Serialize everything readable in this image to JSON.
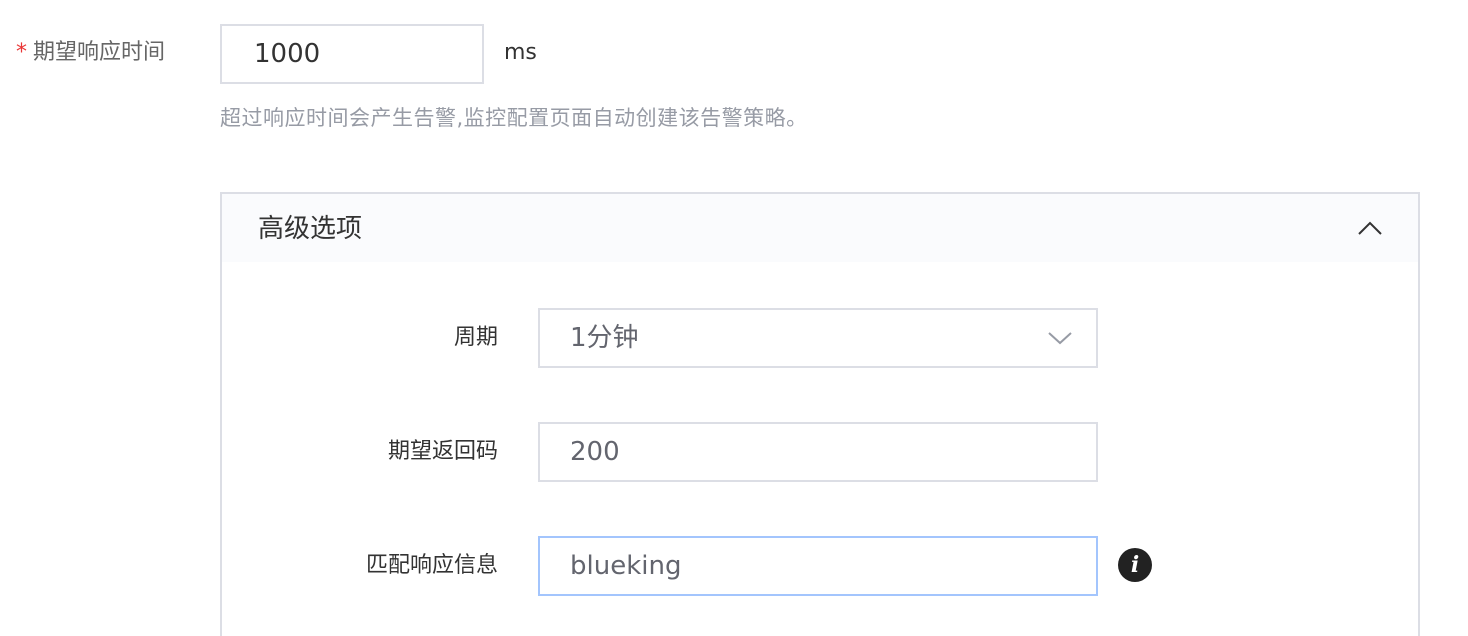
{
  "response_time": {
    "required_mark": "*",
    "label": "期望响应时间",
    "value": "1000",
    "unit": "ms",
    "hint": "超过响应时间会产生告警,监控配置页面自动创建该告警策略。"
  },
  "advanced": {
    "title": "高级选项",
    "toggle_icon": "chevron-up-icon",
    "fields": {
      "period": {
        "label": "周期",
        "selected": "1分钟",
        "arrow_icon": "chevron-down-icon"
      },
      "status_code": {
        "label": "期望返回码",
        "value": "200"
      },
      "match_response": {
        "label": "匹配响应信息",
        "value": "blueking",
        "info_icon": "info-icon",
        "info_glyph": "i"
      }
    }
  }
}
